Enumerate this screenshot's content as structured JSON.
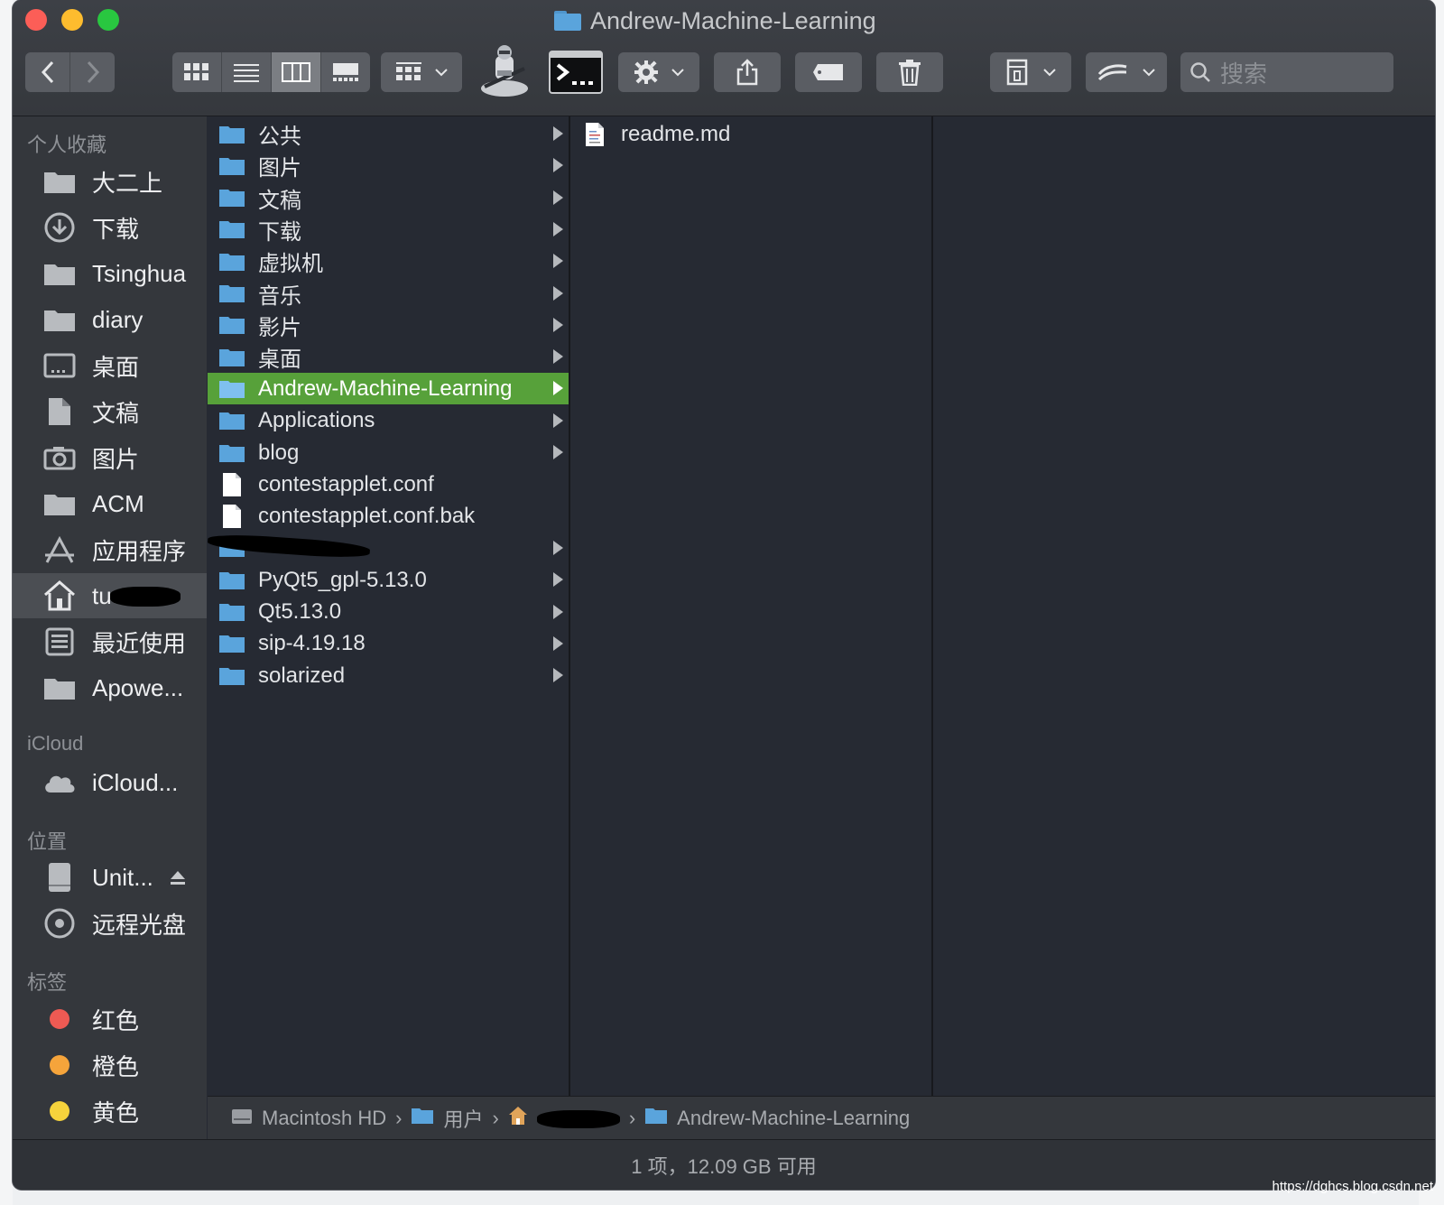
{
  "window": {
    "title": "Andrew-Machine-Learning",
    "folder_color": "#5aa4dc",
    "selection_color": "#57a13a"
  },
  "toolbar": {
    "back": "chevron-left-icon",
    "forward": "chevron-right-icon",
    "view_modes": [
      "icon-view-icon",
      "list-view-icon",
      "column-view-icon",
      "gallery-view-icon"
    ],
    "active_view": "column-view-icon",
    "search_placeholder": "搜索"
  },
  "sidebar": {
    "favorites_header": "个人收藏",
    "favorites": [
      {
        "label": "大二上",
        "icon": "folder-icon"
      },
      {
        "label": "下载",
        "icon": "download-icon"
      },
      {
        "label": "Tsinghua",
        "icon": "folder-icon"
      },
      {
        "label": "diary",
        "icon": "folder-icon"
      },
      {
        "label": "桌面",
        "icon": "desktop-icon"
      },
      {
        "label": "文稿",
        "icon": "document-icon"
      },
      {
        "label": "图片",
        "icon": "camera-icon"
      },
      {
        "label": "ACM",
        "icon": "folder-icon"
      },
      {
        "label": "应用程序",
        "icon": "apps-icon"
      },
      {
        "label": "tu",
        "icon": "home-icon"
      },
      {
        "label": "最近使用",
        "icon": "recents-icon"
      },
      {
        "label": "Apowe...",
        "icon": "folder-icon"
      }
    ],
    "icloud_header": "iCloud",
    "icloud": [
      {
        "label": "iCloud...",
        "icon": "cloud-icon"
      }
    ],
    "locations_header": "位置",
    "locations": [
      {
        "label": "Unit...",
        "icon": "drive-icon"
      },
      {
        "label": "远程光盘",
        "icon": "disc-icon"
      }
    ],
    "tags_header": "标签",
    "tags": [
      {
        "label": "红色",
        "color": "#ee5a53"
      },
      {
        "label": "橙色",
        "color": "#f5a43b"
      },
      {
        "label": "黄色",
        "color": "#f6d33c"
      }
    ]
  },
  "columns": {
    "first": [
      {
        "name": "公共",
        "type": "folder",
        "arrow": true
      },
      {
        "name": "图片",
        "type": "folder",
        "arrow": true
      },
      {
        "name": "文稿",
        "type": "folder",
        "arrow": true
      },
      {
        "name": "下载",
        "type": "folder",
        "arrow": true
      },
      {
        "name": "虚拟机",
        "type": "folder",
        "arrow": true
      },
      {
        "name": "音乐",
        "type": "folder",
        "arrow": true
      },
      {
        "name": "影片",
        "type": "folder",
        "arrow": true
      },
      {
        "name": "桌面",
        "type": "folder",
        "arrow": true
      },
      {
        "name": "Andrew-Machine-Learning",
        "type": "folder",
        "arrow": true,
        "selected": true
      },
      {
        "name": "Applications",
        "type": "folder",
        "arrow": true
      },
      {
        "name": "blog",
        "type": "folder",
        "arrow": true
      },
      {
        "name": "contestapplet.conf",
        "type": "file",
        "arrow": false
      },
      {
        "name": "contestapplet.conf.bak",
        "type": "file",
        "arrow": false
      },
      {
        "name": "",
        "type": "folder",
        "arrow": true,
        "redacted": true
      },
      {
        "name": "PyQt5_gpl-5.13.0",
        "type": "folder",
        "arrow": true
      },
      {
        "name": "Qt5.13.0",
        "type": "folder",
        "arrow": true
      },
      {
        "name": "sip-4.19.18",
        "type": "folder",
        "arrow": true
      },
      {
        "name": "solarized",
        "type": "folder",
        "arrow": true
      }
    ],
    "second": [
      {
        "name": "readme.md",
        "type": "document"
      }
    ]
  },
  "pathbar": {
    "segments": [
      "Macintosh HD",
      "用户",
      "",
      "Andrew-Machine-Learning"
    ]
  },
  "statusbar": {
    "text": "1 项，12.09 GB 可用"
  },
  "watermark": "https://dghcs.blog.csdn.net"
}
